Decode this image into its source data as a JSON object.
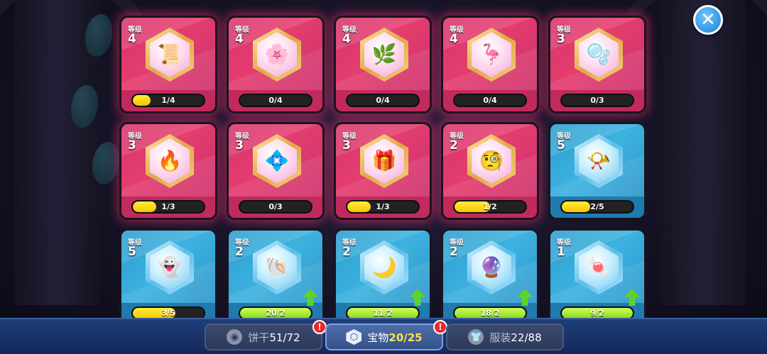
{
  "level_label": "等级",
  "close_icon": "close-icon",
  "cards": [
    {
      "name": "treasure-scroll",
      "theme": "red",
      "level": "4",
      "progress": "1/4",
      "fill": 0.25,
      "icon": "📜",
      "upgrade": false
    },
    {
      "name": "treasure-flower",
      "theme": "red",
      "level": "4",
      "progress": "0/4",
      "fill": 0,
      "icon": "🌸",
      "upgrade": false
    },
    {
      "name": "treasure-branch",
      "theme": "red",
      "level": "4",
      "progress": "0/4",
      "fill": 0,
      "icon": "🌿",
      "upgrade": false
    },
    {
      "name": "treasure-swan",
      "theme": "red",
      "level": "4",
      "progress": "0/4",
      "fill": 0,
      "icon": "🦩",
      "upgrade": false
    },
    {
      "name": "treasure-bubbles",
      "theme": "red",
      "level": "3",
      "progress": "0/3",
      "fill": 0,
      "icon": "🫧",
      "upgrade": false
    },
    {
      "name": "treasure-flame",
      "theme": "red",
      "level": "3",
      "progress": "1/3",
      "fill": 0.33,
      "icon": "🔥",
      "upgrade": false
    },
    {
      "name": "treasure-blue-cloth",
      "theme": "red",
      "level": "3",
      "progress": "0/3",
      "fill": 0,
      "icon": "💠",
      "upgrade": false
    },
    {
      "name": "treasure-wrapped-orb",
      "theme": "red",
      "level": "3",
      "progress": "1/3",
      "fill": 0.33,
      "icon": "🎁",
      "upgrade": false
    },
    {
      "name": "treasure-monocle",
      "theme": "red",
      "level": "2",
      "progress": "1/2",
      "fill": 0.5,
      "icon": "🧐",
      "upgrade": false
    },
    {
      "name": "treasure-horn",
      "theme": "blue",
      "level": "5",
      "progress": "2/5",
      "fill": 0.4,
      "icon": "📯",
      "upgrade": false
    },
    {
      "name": "treasure-ghost",
      "theme": "blue",
      "level": "5",
      "progress": "3/5",
      "fill": 0.6,
      "icon": "👻",
      "upgrade": false
    },
    {
      "name": "treasure-dark-shell",
      "theme": "blue",
      "level": "2",
      "progress": "20/2",
      "fill": 1,
      "icon": "🐚",
      "upgrade": true
    },
    {
      "name": "treasure-scythe",
      "theme": "blue",
      "level": "2",
      "progress": "11/2",
      "fill": 1,
      "icon": "🌙",
      "upgrade": true
    },
    {
      "name": "treasure-ghost-orb",
      "theme": "blue",
      "level": "2",
      "progress": "18/2",
      "fill": 1,
      "icon": "🔮",
      "upgrade": true
    },
    {
      "name": "treasure-candy",
      "theme": "blue",
      "level": "1",
      "progress": "9/2",
      "fill": 1,
      "icon": "🍬",
      "upgrade": true
    }
  ],
  "tabs": [
    {
      "name": "tab-cookies",
      "label": "饼干",
      "count": "51/72",
      "icon": "cookie-icon",
      "glyph": "◉",
      "active": false,
      "alert": true
    },
    {
      "name": "tab-treasures",
      "label": "宝物",
      "count": "20/25",
      "icon": "hexagon-icon",
      "glyph": "⬡",
      "active": true,
      "alert": true
    },
    {
      "name": "tab-costumes",
      "label": "服装",
      "count": "22/88",
      "icon": "shirt-icon",
      "glyph": "👕",
      "active": false,
      "alert": false
    }
  ],
  "alert_mark": "!"
}
